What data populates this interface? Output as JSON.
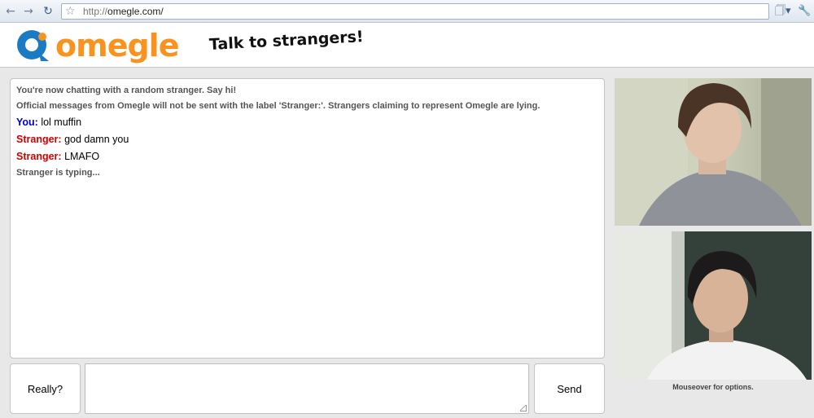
{
  "browser": {
    "url_scheme": "http://",
    "url_host": "omegle.com/",
    "icons": [
      "back-arrow-icon",
      "forward-arrow-icon",
      "reload-icon",
      "star-icon",
      "go-icon",
      "page-menu-icon",
      "wrench-icon"
    ]
  },
  "header": {
    "logo_text": "omegle",
    "tagline": "Talk to strangers!",
    "brand_color": "#f7931e",
    "logo_mark_color": "#1a7bc4"
  },
  "chat": {
    "status_lines": [
      "You're now chatting with a random stranger. Say hi!",
      "Official messages from Omegle will not be sent with the label 'Stranger:'. Strangers claiming to represent Omegle are lying."
    ],
    "messages": [
      {
        "sender": "You:",
        "text": "lol muffin"
      },
      {
        "sender": "Stranger:",
        "text": "god damn you"
      },
      {
        "sender": "Stranger:",
        "text": "LMAFO"
      }
    ],
    "typing_status": "Stranger is typing...",
    "you_color": "#0000cc",
    "stranger_color": "#d00000"
  },
  "controls": {
    "disconnect_label": "Really?",
    "send_label": "Send",
    "message_value": ""
  },
  "video": {
    "caption": "Mouseover for options."
  }
}
